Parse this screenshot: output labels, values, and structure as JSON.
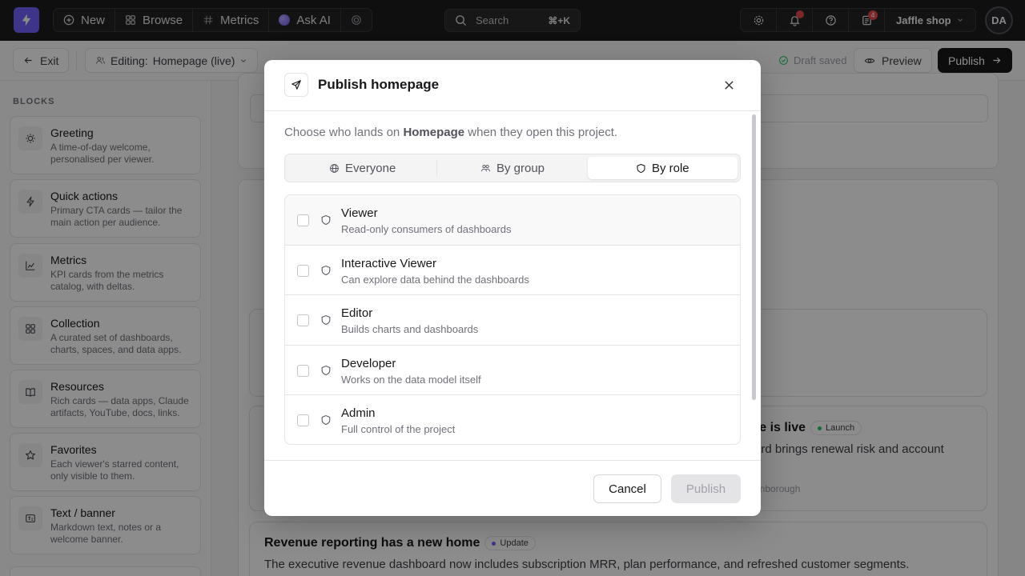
{
  "topnav": {
    "new_label": "New",
    "browse_label": "Browse",
    "metrics_label": "Metrics",
    "askai_label": "Ask AI",
    "search_placeholder": "Search",
    "search_shortcut": "⌘+K",
    "notes_badge": "4",
    "shop_label": "Jaffle shop",
    "avatar_initials": "DA"
  },
  "editbar": {
    "exit_label": "Exit",
    "editing_prefix": "Editing:",
    "editing_value": "Homepage (live)",
    "draft_status": "Draft saved",
    "preview_label": "Preview",
    "publish_label": "Publish"
  },
  "sidebar": {
    "section_label": "BLOCKS",
    "blocks": [
      {
        "title": "Greeting",
        "desc": "A time-of-day welcome, personalised per viewer.",
        "icon": "sun-icon"
      },
      {
        "title": "Quick actions",
        "desc": "Primary CTA cards — tailor the main action per audience.",
        "icon": "bolt-icon"
      },
      {
        "title": "Metrics",
        "desc": "KPI cards from the metrics catalog, with deltas.",
        "icon": "chart-icon"
      },
      {
        "title": "Collection",
        "desc": "A curated set of dashboards, charts, spaces, and data apps.",
        "icon": "grid-icon"
      },
      {
        "title": "Resources",
        "desc": "Rich cards — data apps, Claude artifacts, YouTube, docs, links.",
        "icon": "book-icon"
      },
      {
        "title": "Favorites",
        "desc": "Each viewer's starred content, only visible to them.",
        "icon": "star-icon"
      },
      {
        "title": "Text / banner",
        "desc": "Markdown text, notes or a welcome banner.",
        "icon": "text-icon"
      }
    ]
  },
  "main": {
    "news1": {
      "title_tail": "re is live",
      "tag": "Launch",
      "tag_color": "#22c55e",
      "body_tail": "ard brings renewal risk and account",
      "author_tail": "enborough"
    },
    "news2": {
      "title": "Revenue reporting has a new home",
      "tag": "Update",
      "tag_color": "#7262fd",
      "body": "The executive revenue dashboard now includes subscription MRR, plan performance, and refreshed customer segments."
    }
  },
  "modal": {
    "title": "Publish homepage",
    "subtitle_prefix": "Choose who lands on ",
    "subtitle_bold": "Homepage",
    "subtitle_suffix": " when they open this project.",
    "tabs": [
      {
        "label": "Everyone",
        "icon": "globe-icon"
      },
      {
        "label": "By group",
        "icon": "users-icon"
      },
      {
        "label": "By role",
        "icon": "shield-icon",
        "active": true
      }
    ],
    "roles": [
      {
        "name": "Viewer",
        "desc": "Read-only consumers of dashboards",
        "checked": false
      },
      {
        "name": "Interactive Viewer",
        "desc": "Can explore data behind the dashboards",
        "checked": false
      },
      {
        "name": "Editor",
        "desc": "Builds charts and dashboards",
        "checked": false
      },
      {
        "name": "Developer",
        "desc": "Works on the data model itself",
        "checked": false
      },
      {
        "name": "Admin",
        "desc": "Full control of the project",
        "checked": false
      }
    ],
    "cancel_label": "Cancel",
    "publish_label": "Publish"
  },
  "colors": {
    "brand": "#7262fd",
    "nav_bg": "#1c1c1e",
    "alert": "#e5484d"
  }
}
